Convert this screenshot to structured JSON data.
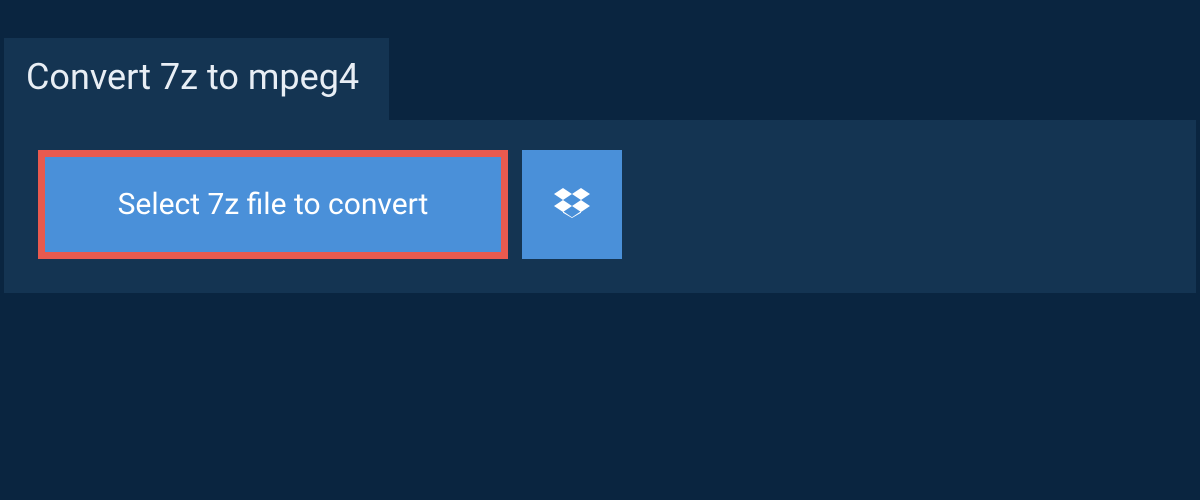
{
  "tab": {
    "title": "Convert 7z to mpeg4"
  },
  "actions": {
    "select_file_label": "Select 7z file to convert",
    "dropbox_icon": "dropbox-icon"
  },
  "colors": {
    "page_bg": "#0a2540",
    "panel_bg": "#143452",
    "button_bg": "#4a90d9",
    "highlight_border": "#e85a4f",
    "text": "#ffffff"
  }
}
